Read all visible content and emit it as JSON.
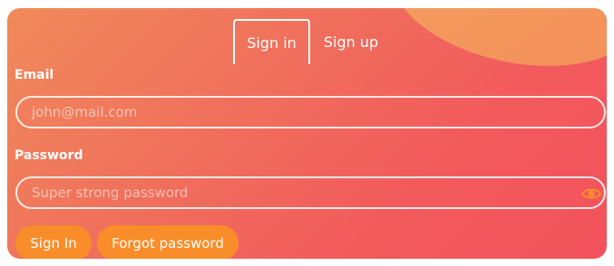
{
  "tabs": [
    {
      "label": "Sign in",
      "active": true
    },
    {
      "label": "Sign up",
      "active": false
    }
  ],
  "form": {
    "email_label": "Email",
    "email_placeholder": "john@mail.com",
    "email_value": "",
    "password_label": "Password",
    "password_placeholder": "Super strong password",
    "password_value": "",
    "password_toggle_icon": "eye-icon"
  },
  "actions": {
    "sign_in_label": "Sign In",
    "forgot_password_label": "Forgot password"
  },
  "colors": {
    "accent": "#f98d2a",
    "gradient_start": "#f08a5a",
    "gradient_end": "#f2525c"
  }
}
